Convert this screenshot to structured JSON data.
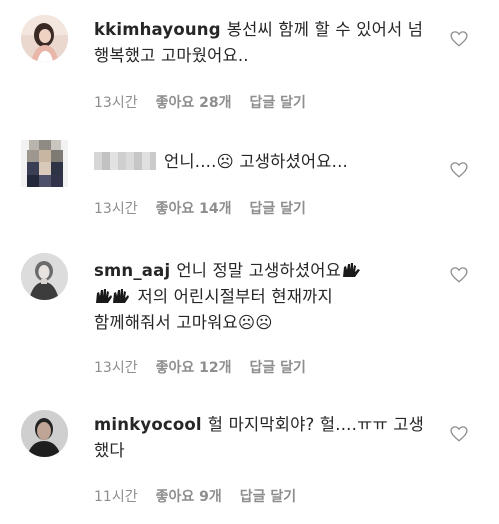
{
  "comments": [
    {
      "username": "kkimhayoung",
      "text": "봉선씨 함께 할 수 있어서 넘 행복했고 고마웠어요..",
      "time": "13시간",
      "likes": "좋아요 28개",
      "reply": "답글 달기",
      "avatar": "woman-portrait-avatar"
    },
    {
      "username": "",
      "text": "언니....☹ 고생하셨어요...",
      "time": "13시간",
      "likes": "좋아요 14개",
      "reply": "답글 달기",
      "avatar": "pixelated-avatar"
    },
    {
      "username": "smn_aaj",
      "text_line1": "언니 정말 고생하셨어요",
      "text_line2": "저의 어린시절부터 현재까지",
      "text_line3": "함께해줘서 고마워요",
      "time": "13시간",
      "likes": "좋아요 12개",
      "reply": "답글 달기",
      "avatar": "woman-gray-avatar"
    },
    {
      "username": "minkyocool",
      "text": "헐 마지막회야? 헐....ㅠㅠ 고생했다",
      "time": "11시간",
      "likes": "좋아요 9개",
      "reply": "답글 달기",
      "avatar": "man-portrait-avatar"
    }
  ],
  "icons": {
    "like": "heart-icon",
    "clap": "clapping-hands-icon",
    "frown": "frowning-face-icon"
  },
  "colors": {
    "text": "#262626",
    "meta": "#8e8e8e",
    "background": "#ffffff"
  }
}
